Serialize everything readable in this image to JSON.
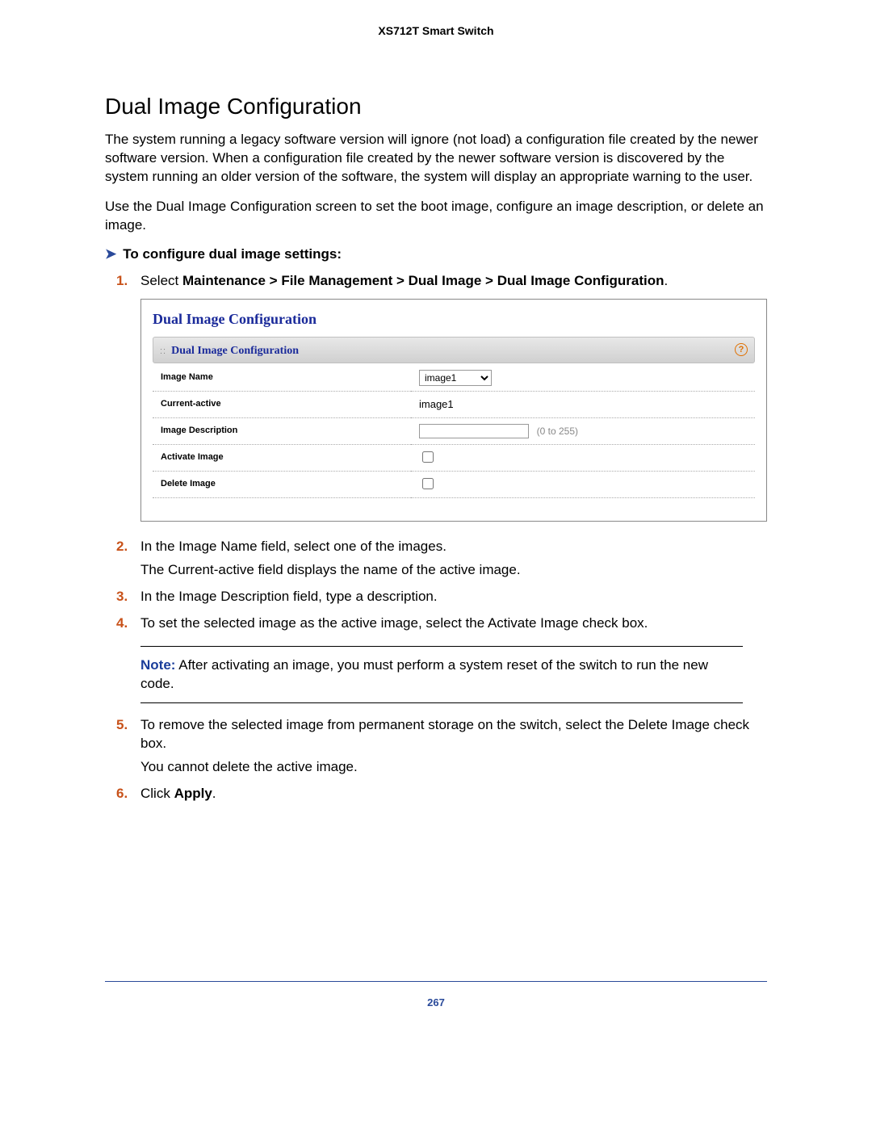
{
  "header": {
    "product": "XS712T Smart Switch"
  },
  "section": {
    "title": "Dual Image Configuration",
    "para1": "The system running a legacy software version will ignore (not load) a configuration file created by the newer software version. When a configuration file created by the newer software version is discovered by the system running an older version of the software, the system will display an appropriate warning to the user.",
    "para2": "Use the Dual Image Configuration screen to set the boot image, configure an image description, or delete an image."
  },
  "task": {
    "heading": "To configure dual image settings:"
  },
  "steps": {
    "s1_prefix": "Select ",
    "s1_bold": "Maintenance > File Management > Dual Image > Dual Image Configuration",
    "s1_suffix": ".",
    "s2": "In the Image Name field, select one of the images.",
    "s2b": "The Current-active field displays the name of the active image.",
    "s3": "In the Image Description field, type a description.",
    "s4": "To set the selected image as the active image, select the Activate Image check box.",
    "s5": "To remove the selected image from permanent storage on the switch, select the Delete Image check box.",
    "s5b": "You cannot delete the active image.",
    "s6_prefix": "Click ",
    "s6_bold": "Apply",
    "s6_suffix": "."
  },
  "note": {
    "label": "Note:",
    "text": " After activating an image, you must perform a system reset of the switch to run the new code."
  },
  "panel": {
    "title": "Dual Image Configuration",
    "bar_title": "Dual Image Configuration",
    "rows": {
      "image_name_label": "Image Name",
      "image_name_value": "image1",
      "current_active_label": "Current-active",
      "current_active_value": "image1",
      "image_desc_label": "Image Description",
      "image_desc_hint": "(0 to 255)",
      "activate_label": "Activate Image",
      "delete_label": "Delete Image"
    }
  },
  "footer": {
    "page_number": "267"
  }
}
